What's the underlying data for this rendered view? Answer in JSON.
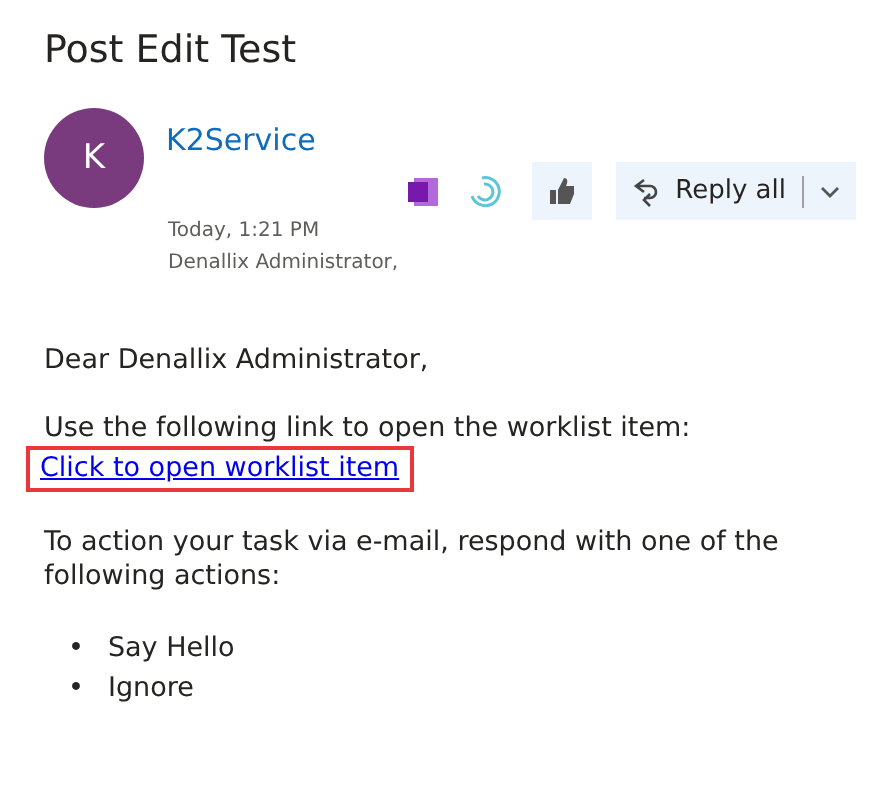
{
  "subject": "Post Edit Test",
  "sender": {
    "initial": "K",
    "name": "K2Service",
    "time": "Today, 1:21 PM",
    "to": "Denallix Administrator,"
  },
  "actions": {
    "reply_all": "Reply all"
  },
  "body": {
    "greeting": "Dear Denallix Administrator,",
    "intro": "Use the following link to open the worklist item:",
    "link": {
      "text": "Click to open worklist item",
      "highlighted": true
    },
    "instructions": "To action your task via e-mail, respond with one of the following actions:",
    "options": [
      {
        "bullet": "•",
        "text": "Say Hello"
      },
      {
        "bullet": "•",
        "text": "Ignore"
      }
    ]
  }
}
